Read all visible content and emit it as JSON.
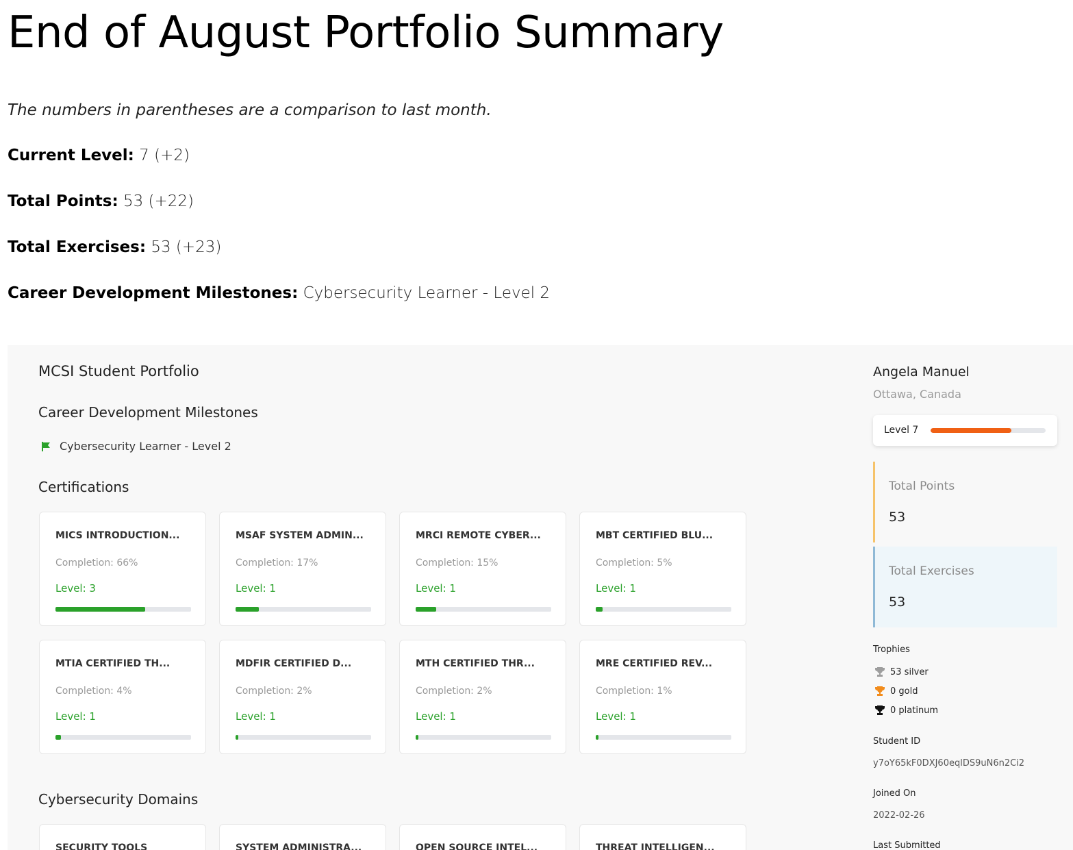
{
  "title": "End of August Portfolio Summary",
  "note": "The numbers in parentheses are a comparison to last month.",
  "summary": {
    "level": {
      "label": "Current Level:",
      "value": "7 (+2)"
    },
    "points": {
      "label": "Total Points:",
      "value": "53 (+22)"
    },
    "exercises": {
      "label": "Total Exercises:",
      "value": "53 (+23)"
    },
    "milestones": {
      "label": "Career Development Milestones:",
      "value": "Cybersecurity Learner - Level 2"
    }
  },
  "portfolio": {
    "title": "MCSI Student Portfolio",
    "milestones_heading": "Career Development Milestones",
    "milestone_item": "Cybersecurity Learner - Level 2",
    "certifications_heading": "Certifications",
    "certifications": [
      {
        "title": "MICS INTRODUCTION...",
        "completion": "Completion: 66%",
        "level": "Level: 3",
        "progress": 0.66
      },
      {
        "title": "MSAF SYSTEM ADMIN...",
        "completion": "Completion: 17%",
        "level": "Level: 1",
        "progress": 0.17
      },
      {
        "title": "MRCI REMOTE CYBER...",
        "completion": "Completion: 15%",
        "level": "Level: 1",
        "progress": 0.15
      },
      {
        "title": "MBT CERTIFIED BLU...",
        "completion": "Completion: 5%",
        "level": "Level: 1",
        "progress": 0.05
      },
      {
        "title": "MTIA CERTIFIED TH...",
        "completion": "Completion: 4%",
        "level": "Level: 1",
        "progress": 0.04
      },
      {
        "title": "MDFIR CERTIFIED D...",
        "completion": "Completion: 2%",
        "level": "Level: 1",
        "progress": 0.02
      },
      {
        "title": "MTH CERTIFIED THR...",
        "completion": "Completion: 2%",
        "level": "Level: 1",
        "progress": 0.02
      },
      {
        "title": "MRE CERTIFIED REV...",
        "completion": "Completion: 1%",
        "level": "Level: 1",
        "progress": 0.01
      }
    ],
    "domains_heading": "Cybersecurity Domains",
    "domains": [
      {
        "title": "SECURITY TOOLS"
      },
      {
        "title": "SYSTEM ADMINISTRA..."
      },
      {
        "title": "OPEN SOURCE INTEL..."
      },
      {
        "title": "THREAT INTELLIGEN..."
      }
    ]
  },
  "profile": {
    "name": "Angela Manuel",
    "location": "Ottawa, Canada",
    "level_label": "Level 7",
    "level_progress": 0.7,
    "total_points_label": "Total Points",
    "total_points": "53",
    "total_exercises_label": "Total Exercises",
    "total_exercises": "53",
    "trophies_heading": "Trophies",
    "trophies": {
      "silver": "53 silver",
      "gold": "0 gold",
      "platinum": "0 platinum"
    },
    "student_id_heading": "Student ID",
    "student_id": "y7oY65kF0DXJ60eqlDS9uN6n2Ci2",
    "joined_heading": "Joined On",
    "joined": "2022-02-26",
    "last_submitted_heading": "Last Submitted"
  },
  "colors": {
    "accent_green": "#2aa12a",
    "level_orange": "#f06014",
    "points_border": "#f6c36a",
    "exercises_border": "#8fb9d6",
    "exercises_bg": "#eef6fa",
    "panel_bg": "#f8f8f8"
  }
}
